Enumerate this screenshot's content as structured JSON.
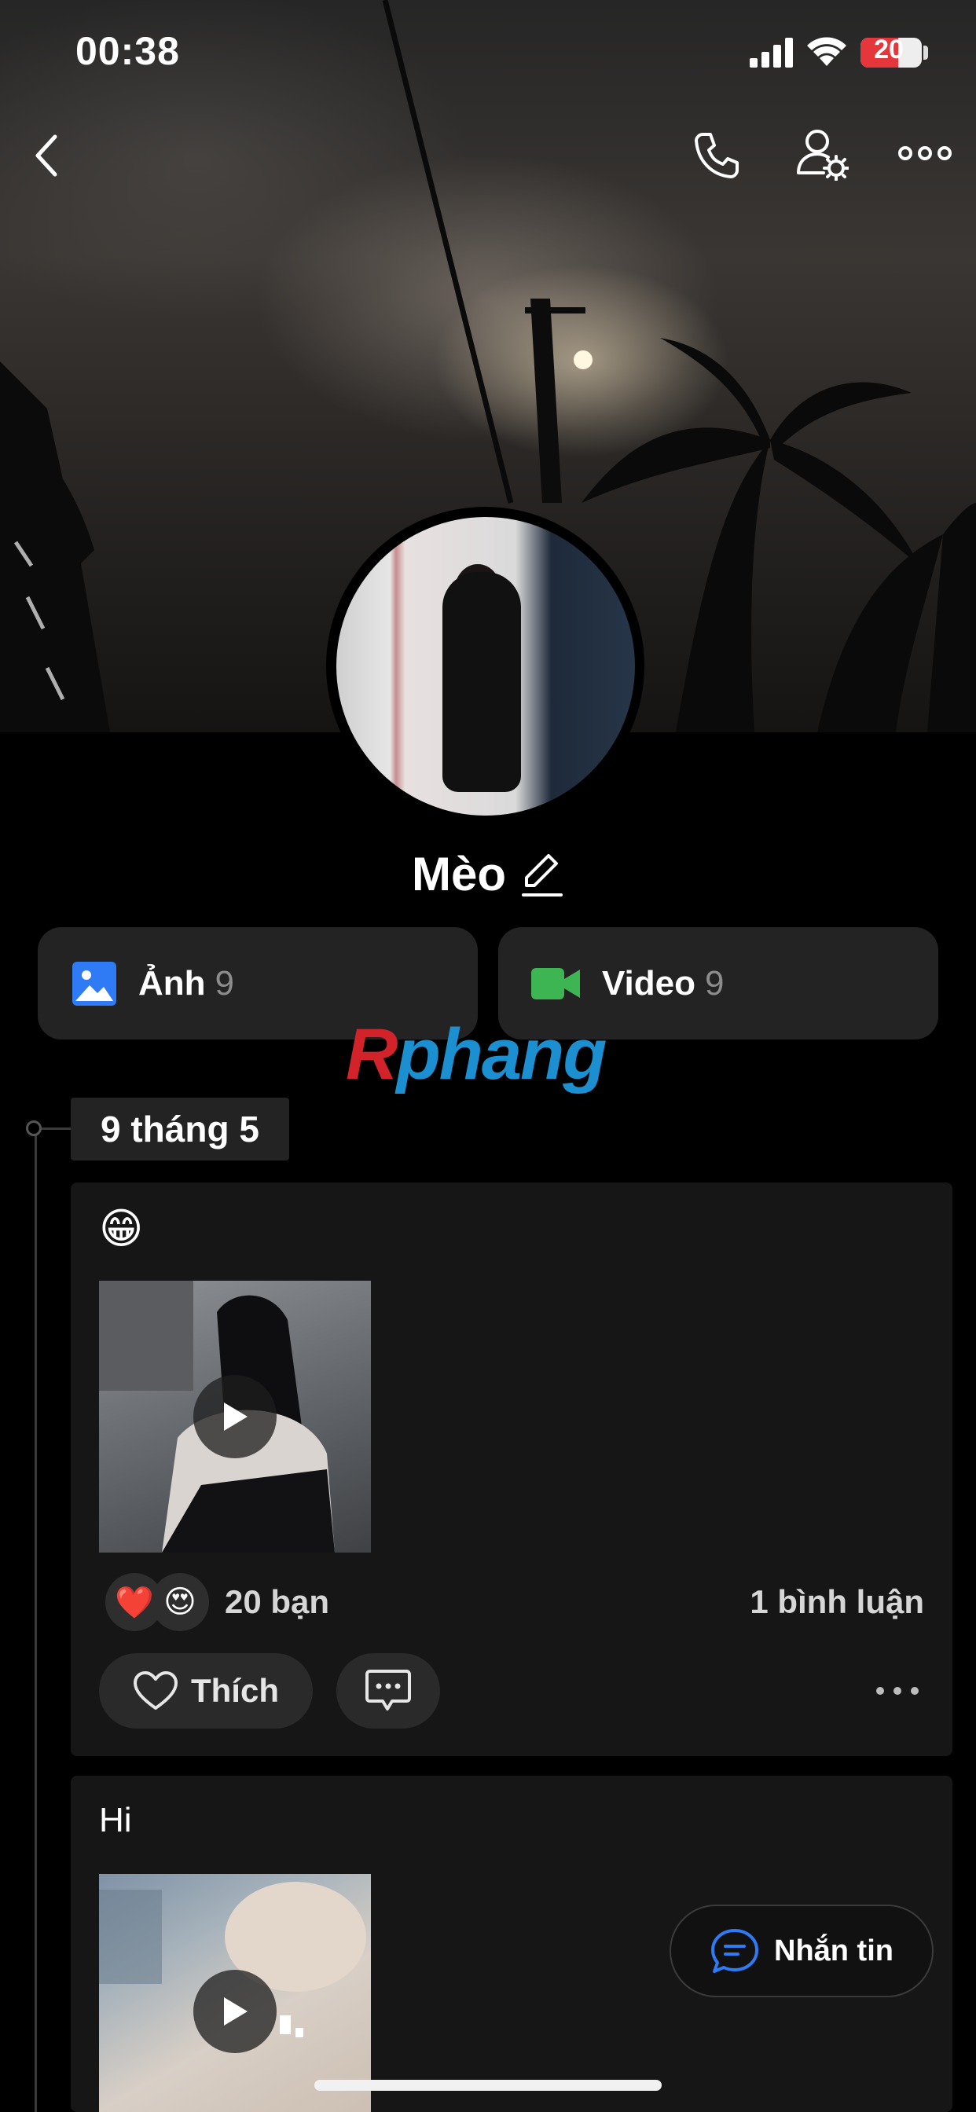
{
  "status_bar": {
    "time": "00:38",
    "battery_level": "20",
    "icons": [
      "signal-icon",
      "wifi-icon",
      "battery-icon"
    ]
  },
  "header": {
    "icons": [
      "back-icon",
      "phone-icon",
      "user-settings-icon",
      "more-icon"
    ]
  },
  "profile": {
    "name": "Mèo",
    "edit_icon": "pencil-icon"
  },
  "media": {
    "photos": {
      "label": "Ảnh",
      "count": "9",
      "icon": "image-icon",
      "color": "#2f7bf6"
    },
    "videos": {
      "label": "Video",
      "count": "9",
      "icon": "video-icon",
      "color": "#3cb552"
    }
  },
  "watermark": {
    "first": "R",
    "rest": "phang"
  },
  "timeline": {
    "date": "9 tháng 5",
    "posts": [
      {
        "text": "😁",
        "media_type": "video",
        "reactions": [
          "❤️",
          "😍"
        ],
        "reaction_count": "20 bạn",
        "comment_count": "1 bình luận",
        "like_label": "Thích"
      },
      {
        "text": "Hi",
        "media_type": "video"
      }
    ]
  },
  "message_button": {
    "label": "Nhắn tin",
    "icon": "chat-icon"
  },
  "colors": {
    "background": "#000000",
    "card": "#161616",
    "accent_blue": "#2f7bf6"
  }
}
